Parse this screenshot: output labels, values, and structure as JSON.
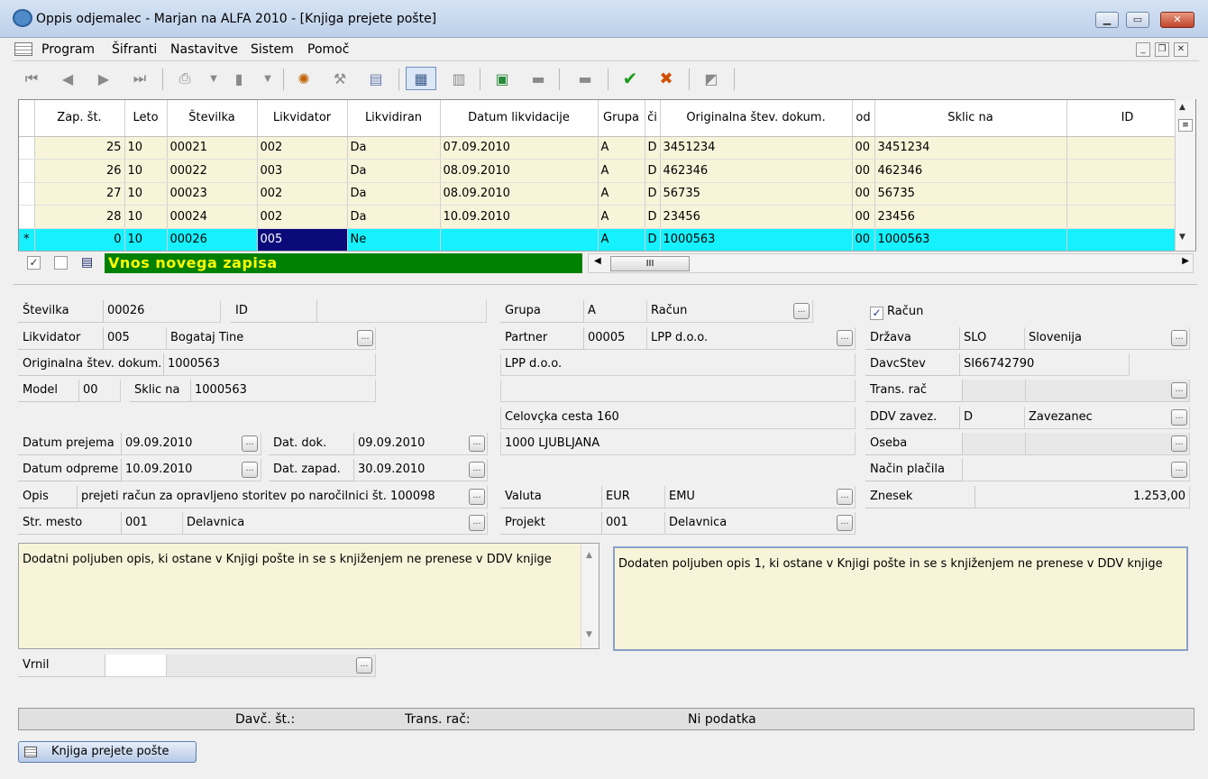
{
  "window": {
    "title": "Oppis odjemalec - Marjan na ALFA 2010 - [Knjiga prejete pošte]"
  },
  "menu": {
    "items": [
      "Program",
      "Šifranti",
      "Nastavitve",
      "Sistem",
      "Pomoč"
    ]
  },
  "grid": {
    "columns": [
      "Zap. št.",
      "Leto",
      "Številka",
      "Likvidator",
      "Likvidiran",
      "Datum likvidacije",
      "Grupa",
      "či",
      "Originalna štev. dokum.",
      "od",
      "Sklic na",
      "ID"
    ],
    "rows": [
      [
        "25",
        "10",
        "00021",
        "002",
        "Da",
        "07.09.2010",
        "A",
        "D",
        "3451234",
        "00",
        "3451234",
        ""
      ],
      [
        "26",
        "10",
        "00022",
        "003",
        "Da",
        "08.09.2010",
        "A",
        "D",
        "462346",
        "00",
        "462346",
        ""
      ],
      [
        "27",
        "10",
        "00023",
        "002",
        "Da",
        "08.09.2010",
        "A",
        "D",
        "56735",
        "00",
        "56735",
        ""
      ],
      [
        "28",
        "10",
        "00024",
        "002",
        "Da",
        "10.09.2010",
        "A",
        "D",
        "23456",
        "00",
        "23456",
        ""
      ],
      [
        "0",
        "10",
        "00026",
        "005",
        "Ne",
        "",
        "A",
        "D",
        "1000563",
        "00",
        "1000563",
        ""
      ]
    ],
    "new_row_marker": "*",
    "status": "Vnos novega zapisa",
    "hscroll_thumb": "III"
  },
  "form": {
    "stevilka_label": "Številka",
    "stevilka": "00026",
    "id_label": "ID",
    "id": "",
    "likvidator_label": "Likvidator",
    "likvidator_code": "005",
    "likvidator_name": "Bogataj Tine",
    "orig_label": "Originalna štev. dokum.",
    "orig": "1000563",
    "model_label": "Model",
    "model": "00",
    "sklic_label": "Sklic na",
    "sklic": "1000563",
    "datum_prejema_label": "Datum prejema",
    "datum_prejema": "09.09.2010",
    "dat_dok_label": "Dat. dok.",
    "dat_dok": "09.09.2010",
    "datum_odpreme_label": "Datum odpreme",
    "datum_odpreme": "10.09.2010",
    "dat_zapad_label": "Dat. zapad.",
    "dat_zapad": "30.09.2010",
    "opis_label": "Opis",
    "opis": "prejeti račun za opravljeno storitev po naročilnici št. 100098",
    "str_mesto_label": "Str. mesto",
    "str_mesto_code": "001",
    "str_mesto_name": "Delavnica",
    "grupa_label": "Grupa",
    "grupa": "A",
    "grupa_name": "Račun",
    "partner_label": "Partner",
    "partner_code": "00005",
    "partner_name": "LPP d.o.o.",
    "addr1": "LPP d.o.o.",
    "addr2": "",
    "addr3": "Celovçka cesta 160",
    "addr4": "1000  LJUBLJANA",
    "valuta_label": "Valuta",
    "valuta": "EUR",
    "valuta_name": "EMU",
    "projekt_label": "Projekt",
    "projekt_code": "001",
    "projekt_name": "Delavnica",
    "racun_check_label": "Račun",
    "drzava_label": "Država",
    "drzava": "SLO",
    "drzava_name": "Slovenija",
    "davcstev_label": "DavcStev",
    "davcstev": "SI66742790",
    "trans_rac_label": "Trans. rač",
    "ddv_label": "DDV zavez.",
    "ddv": "D",
    "ddv_name": "Zavezanec",
    "oseba_label": "Oseba",
    "nacin_label": "Način plačila",
    "znesek_label": "Znesek",
    "znesek": "1.253,00",
    "memo1": "Dodatni poljuben opis, ki ostane v Knjigi pošte in se s knjiženjem ne prenese v DDV knjige",
    "memo2": "Dodaten poljuben opis 1, ki ostane v Knjigi pošte in se s knjiženjem ne prenese v DDV knjige",
    "vrnil_label": "Vrnil"
  },
  "statusbar": {
    "davc": "Davč. št.:",
    "trans": "Trans. rač:",
    "ni": "Ni podatka"
  },
  "bottom_tab": "Knjiga prejete pošte",
  "colors": {
    "grid_row": "#f7f4d9",
    "selected_row": "#16f1ff",
    "status_bg": "#008000",
    "status_fg": "#ffff00"
  }
}
